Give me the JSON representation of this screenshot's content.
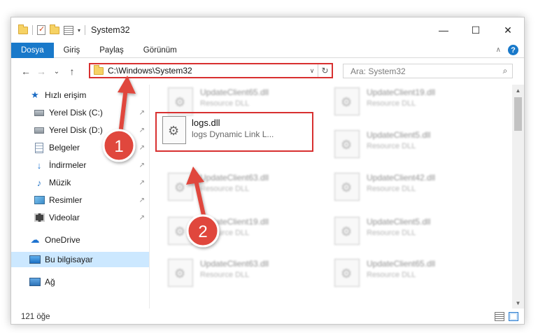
{
  "titlebar": {
    "title": "System32",
    "minimize": "—",
    "maximize": "☐",
    "close": "✕",
    "qat_dropdown": "▾"
  },
  "ribbon": {
    "tabs": [
      "Dosya",
      "Giriş",
      "Paylaş",
      "Görünüm"
    ],
    "help": "?",
    "collapse": "∧"
  },
  "nav": {
    "back": "←",
    "forward": "→",
    "recent": "⌄",
    "up": "↑",
    "address": "C:\\Windows\\System32",
    "address_dropdown": "∨",
    "refresh": "↻",
    "search_placeholder": "Ara: System32",
    "search_icon": "⌕"
  },
  "sidebar": {
    "items": [
      {
        "label": "Hızlı erişim",
        "icon": "star-icon",
        "pinned": false
      },
      {
        "label": "Yerel Disk (C:)",
        "icon": "drive-icon",
        "pinned": true
      },
      {
        "label": "Yerel Disk (D:)",
        "icon": "drive-icon",
        "pinned": true
      },
      {
        "label": "Belgeler",
        "icon": "document-icon",
        "pinned": true
      },
      {
        "label": "İndirmeler",
        "icon": "download-icon",
        "pinned": true
      },
      {
        "label": "Müzik",
        "icon": "music-icon",
        "pinned": true
      },
      {
        "label": "Resimler",
        "icon": "pictures-icon",
        "pinned": true
      },
      {
        "label": "Videolar",
        "icon": "videos-icon",
        "pinned": true
      },
      {
        "label": "OneDrive",
        "icon": "onedrive-icon",
        "pinned": false
      },
      {
        "label": "Bu bilgisayar",
        "icon": "this-pc-icon",
        "pinned": false,
        "selected": true
      },
      {
        "label": "Ağ",
        "icon": "network-icon",
        "pinned": false
      }
    ],
    "pin_glyph": "↗"
  },
  "files": {
    "blurred": [
      {
        "name": "UpdateClient65.dll",
        "desc": "Resource DLL"
      },
      {
        "name": "UpdateClient19.dll",
        "desc": "Resource DLL"
      },
      {
        "name": "UpdateClient5.dll",
        "desc": "Resource DLL"
      },
      {
        "name": "UpdateClient63.dll",
        "desc": "Resource DLL"
      },
      {
        "name": "UpdateClient42.dll",
        "desc": "Resource DLL"
      },
      {
        "name": "UpdateClient19.dll",
        "desc": "Resource DLL"
      },
      {
        "name": "UpdateClient5.dll",
        "desc": "Resource DLL"
      },
      {
        "name": "UpdateClient63.dll",
        "desc": "Resource DLL"
      },
      {
        "name": "UpdateClient65.dll",
        "desc": "Resource DLL"
      }
    ],
    "target": {
      "name": "logs.dll",
      "desc": "logs Dynamic Link L..."
    }
  },
  "status": {
    "item_count": "121 öğe"
  },
  "annotations": {
    "badge1": "1",
    "badge2": "2",
    "color": "#d83030"
  }
}
